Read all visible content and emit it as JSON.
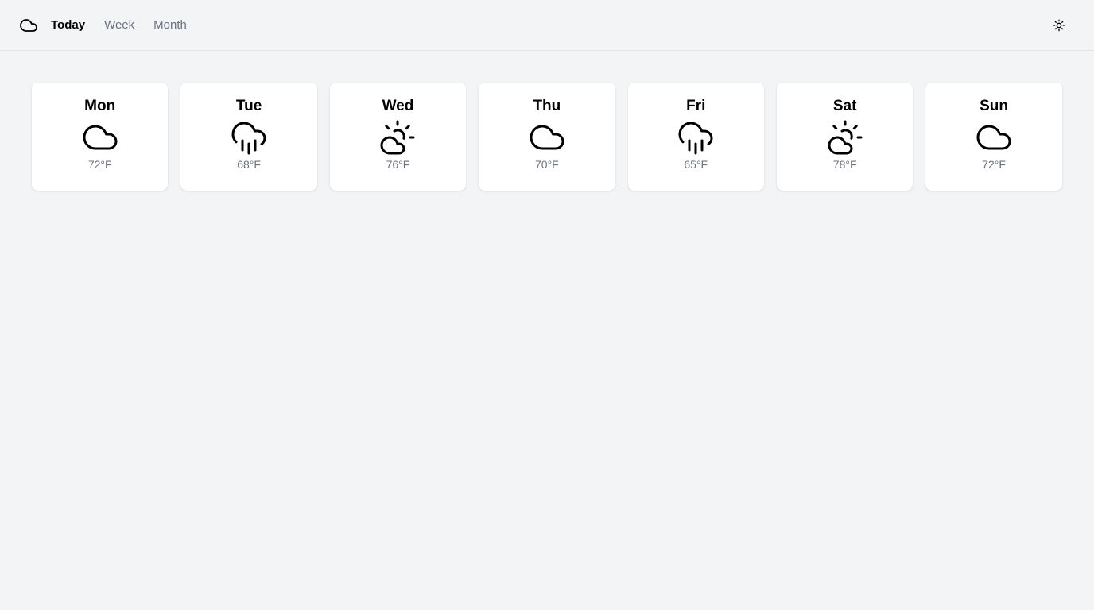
{
  "header": {
    "logo_icon": "cloud-icon",
    "nav": [
      {
        "label": "Today",
        "active": true
      },
      {
        "label": "Week",
        "active": false
      },
      {
        "label": "Month",
        "active": false
      }
    ],
    "theme_icon": "sun-icon"
  },
  "forecast": [
    {
      "day": "Mon",
      "temp": "72°F",
      "icon": "cloud-icon"
    },
    {
      "day": "Tue",
      "temp": "68°F",
      "icon": "cloud-rain-icon"
    },
    {
      "day": "Wed",
      "temp": "76°F",
      "icon": "partly-sunny-icon"
    },
    {
      "day": "Thu",
      "temp": "70°F",
      "icon": "cloud-icon"
    },
    {
      "day": "Fri",
      "temp": "65°F",
      "icon": "cloud-rain-icon"
    },
    {
      "day": "Sat",
      "temp": "78°F",
      "icon": "partly-sunny-icon"
    },
    {
      "day": "Sun",
      "temp": "72°F",
      "icon": "cloud-icon"
    }
  ],
  "colors": {
    "background": "#f3f4f6",
    "card": "#ffffff",
    "muted_text": "#6b7280",
    "active_text": "#000000"
  }
}
